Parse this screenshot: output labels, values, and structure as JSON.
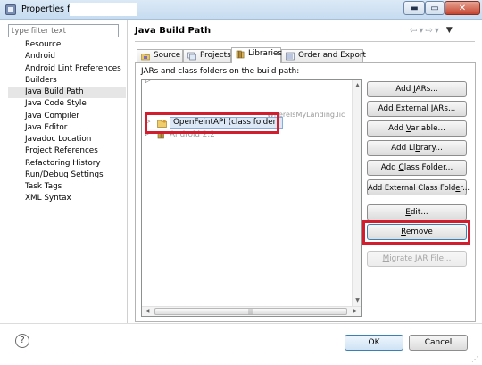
{
  "window": {
    "title": "Properties for",
    "controls": {
      "minimize": "▬",
      "maximize": "▭",
      "close": "✕"
    }
  },
  "sidebar": {
    "filter_placeholder": "type filter text",
    "items": [
      {
        "label": "Resource",
        "expandable": true
      },
      {
        "label": "Android",
        "expandable": false
      },
      {
        "label": "Android Lint Preferences",
        "expandable": false
      },
      {
        "label": "Builders",
        "expandable": false
      },
      {
        "label": "Java Build Path",
        "expandable": false,
        "selected": true
      },
      {
        "label": "Java Code Style",
        "expandable": true
      },
      {
        "label": "Java Compiler",
        "expandable": true
      },
      {
        "label": "Java Editor",
        "expandable": true
      },
      {
        "label": "Javadoc Location",
        "expandable": false
      },
      {
        "label": "Project References",
        "expandable": false
      },
      {
        "label": "Refactoring History",
        "expandable": false
      },
      {
        "label": "Run/Debug Settings",
        "expandable": false
      },
      {
        "label": "Task Tags",
        "expandable": true
      },
      {
        "label": "XML Syntax",
        "expandable": true
      }
    ]
  },
  "page": {
    "title": "Java Build Path",
    "history": {
      "back": "⇦",
      "back_menu": "▾",
      "forward": "⇨",
      "forward_menu": "▾",
      "view_menu": "▼"
    }
  },
  "tabs": [
    {
      "label": "Source"
    },
    {
      "label": "Projects"
    },
    {
      "label": "Libraries",
      "active": true
    },
    {
      "label": "Order and Export"
    }
  ],
  "libraries": {
    "label": "JARs and class folders on the build path:",
    "rows": [
      {
        "label": "",
        "faded": true
      },
      {
        "label": "WhereIsMyLanding.lic",
        "faded": true
      },
      {
        "label": "OpenFeintAPI (class folder)",
        "selected": true
      },
      {
        "label": "Android 2.2",
        "faded": true
      }
    ],
    "scroll": {
      "up": "▲",
      "down": "▼",
      "left": "◀",
      "right": "▶",
      "thumb_grip": "|||"
    }
  },
  "buttons": {
    "add_jars": {
      "pre": "Add ",
      "u": "J",
      "post": "ARs..."
    },
    "add_external_jars": {
      "pre": "Add E",
      "u": "x",
      "post": "ternal JARs..."
    },
    "add_variable": {
      "pre": "Add ",
      "u": "V",
      "post": "ariable..."
    },
    "add_library": {
      "pre": "Add Li",
      "u": "b",
      "post": "rary..."
    },
    "add_class_folder": {
      "pre": "Add ",
      "u": "C",
      "post": "lass Folder..."
    },
    "add_external_class_folder": {
      "pre": "Add External Class Fold",
      "u": "e",
      "post": "r..."
    },
    "edit": {
      "pre": "",
      "u": "E",
      "post": "dit..."
    },
    "remove": {
      "pre": "",
      "u": "R",
      "post": "emove"
    },
    "migrate_jar": {
      "pre": "",
      "u": "M",
      "post": "igrate JAR File..."
    }
  },
  "footer": {
    "help": "?",
    "ok": "OK",
    "cancel": "Cancel"
  },
  "colors": {
    "highlight": "#d11d2d",
    "selection_bg": "#dde8f6",
    "selection_border": "#84acdd",
    "titlebar": "#c7dcf1"
  }
}
